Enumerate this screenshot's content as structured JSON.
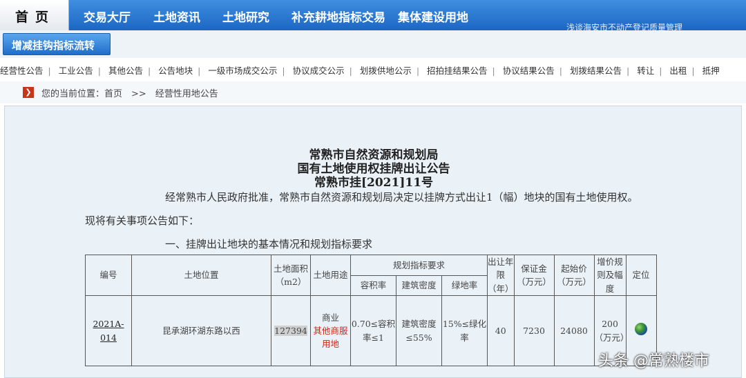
{
  "nav": {
    "home": "首页",
    "items": [
      "交易大厅",
      "土地资讯",
      "土地研究",
      "补充耕地指标交易",
      "集体建设用地"
    ],
    "subtitle": "浅谈海安市不动产登记质量管理"
  },
  "banner": {
    "button": "增减挂钩指标流转"
  },
  "categories": [
    "经营性公告",
    "工业公告",
    "其他公告",
    "公告地块",
    "一级市场成交公示",
    "协议成交公示",
    "划拨供地公示",
    "招拍挂结果公告",
    "协议结果公告",
    "划拨结果公告",
    "转让",
    "出租",
    "抵押"
  ],
  "breadcrumb": {
    "icon": "arrow-right-icon",
    "text": "您的当前位置：首页　>>　经营性用地公告"
  },
  "notice": {
    "title1": "常熟市自然资源和规划局",
    "title2": "国有土地使用权挂牌出让公告",
    "title3": "常熟市挂[2021]11号",
    "intro": "经常熟市人民政府批准，常熟市自然资源和规划局决定以挂牌方式出让1（幅）地块的国有土地使用权。",
    "lead": "现将有关事项公告如下：",
    "section1": "一、挂牌出让地块的基本情况和规划指标要求"
  },
  "table": {
    "headers": {
      "code": "编号",
      "location": "土地位置",
      "area": "土地面积（m2）",
      "use": "土地用途",
      "plan": "规划指标要求",
      "far": "容积率",
      "density": "建筑密度",
      "green": "绿地率",
      "term": "出让年限（年）",
      "deposit": "保证金（万元）",
      "start_price": "起始价（万元）",
      "increment": "增价规则及幅度",
      "position": "定位"
    },
    "row": {
      "code": "2021A-014",
      "location": "昆承湖环湖东路以西",
      "area": "127394",
      "use1": "商业",
      "use2": "其他商服用地",
      "far": "0.70≤容积率≤1",
      "density": "建筑密度≤55%",
      "green": "15%≤绿化率",
      "term": "40",
      "deposit": "7230",
      "start_price": "24080",
      "increment": "200（万元）",
      "position_icon": "globe-icon"
    }
  },
  "watermark": "头条 @常熟楼市",
  "colors": {
    "nav_bg": "#1c66c4",
    "panel_bg": "#eaf1f7",
    "accent_red": "#d0261a"
  }
}
